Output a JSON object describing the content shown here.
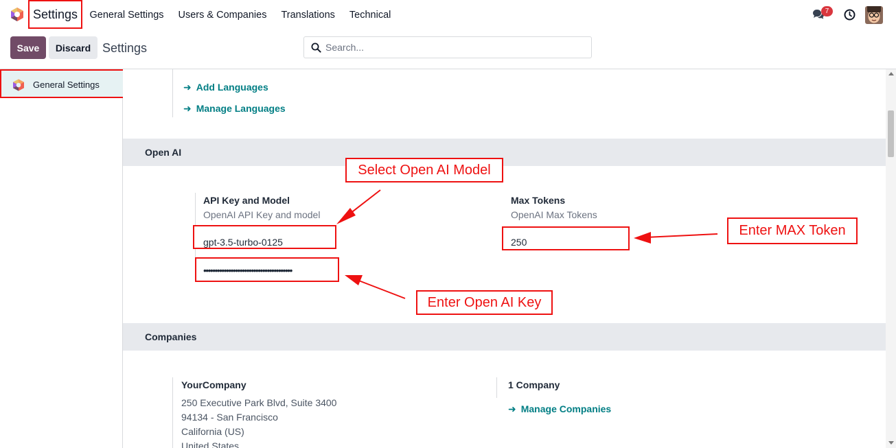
{
  "navbar": {
    "app_name": "Settings",
    "menu": [
      "General Settings",
      "Users & Companies",
      "Translations",
      "Technical"
    ],
    "notification_count": "7"
  },
  "control_panel": {
    "save_label": "Save",
    "discard_label": "Discard",
    "breadcrumb": "Settings",
    "search_placeholder": "Search..."
  },
  "sidebar": {
    "items": [
      {
        "label": "General Settings"
      }
    ]
  },
  "languages": {
    "links": [
      "Add Languages",
      "Manage Languages"
    ]
  },
  "openai": {
    "section_title": "Open AI",
    "api": {
      "title": "API Key and Model",
      "description": "OpenAI API Key and model",
      "model_value": "gpt-3.5-turbo-0125",
      "key_masked": "•••••••••••••••••••••••••••••••••••••••"
    },
    "tokens": {
      "title": "Max Tokens",
      "description": "OpenAI Max Tokens",
      "value": "250"
    }
  },
  "companies": {
    "section_title": "Companies",
    "company_name": "YourCompany",
    "address_lines": [
      "250 Executive Park Blvd, Suite 3400",
      "94134 - San Francisco",
      "California (US)",
      "United States"
    ],
    "count_label": "1 Company",
    "manage_link": "Manage Companies"
  },
  "annotations": {
    "select_model": "Select Open AI Model",
    "max_token": "Enter MAX Token",
    "openai_key": "Enter Open AI Key",
    "color": "#ee1111"
  },
  "colors": {
    "brand": "#714b67",
    "link": "#017e84",
    "sidebar_active": "#e6f2f3",
    "badge": "#d9363e"
  }
}
